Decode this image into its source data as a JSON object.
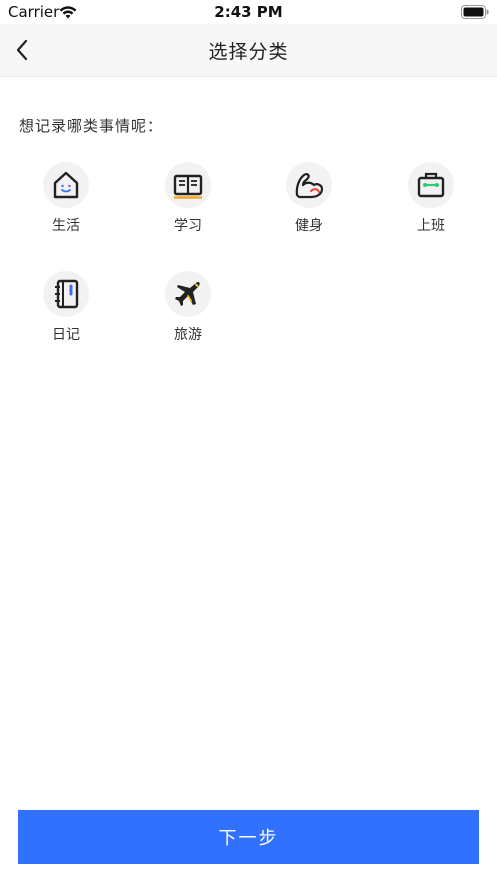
{
  "status_bar": {
    "carrier": "Carrier",
    "time": "2:43 PM"
  },
  "nav": {
    "title": "选择分类"
  },
  "prompt": "想记录哪类事情呢：",
  "categories": [
    {
      "label": "生活",
      "icon": "home-icon"
    },
    {
      "label": "学习",
      "icon": "book-icon"
    },
    {
      "label": "健身",
      "icon": "muscle-arm-icon"
    },
    {
      "label": "上班",
      "icon": "briefcase-icon"
    },
    {
      "label": "日记",
      "icon": "notebook-icon"
    },
    {
      "label": "旅游",
      "icon": "airplane-icon"
    }
  ],
  "next_button": {
    "label": "下一步"
  },
  "colors": {
    "accent": "#3271fd",
    "icon_orange": "#f5a623",
    "icon_green": "#2ecc71",
    "icon_blue": "#3b6df5"
  }
}
